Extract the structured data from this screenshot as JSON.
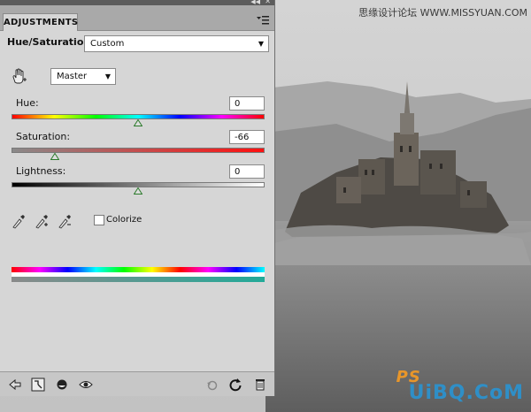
{
  "panel": {
    "tab_label": "ADJUSTMENTS",
    "title": "Hue/Saturation",
    "preset_value": "Custom",
    "channel_value": "Master",
    "hue": {
      "label": "Hue:",
      "value": "0",
      "level": 0.5
    },
    "saturation": {
      "label": "Saturation:",
      "value": "-66",
      "level": 0.17
    },
    "lightness": {
      "label": "Lightness:",
      "value": "0",
      "level": 0.5
    },
    "colorize_label": "Colorize",
    "colorize_checked": false
  },
  "watermark": {
    "top_text": "思缘设计论坛  WWW.MISSYUAN.COM",
    "logo_text": "UiBQ.CoM",
    "logo_ps": "PS"
  },
  "icons": [
    "hand-icon",
    "eyedropper-icon",
    "eyedropper-plus-icon",
    "eyedropper-minus-icon",
    "back-arrow-icon",
    "clip-layer-icon",
    "visibility-icon",
    "eye-icon",
    "reset-previous-icon",
    "reset-icon",
    "trash-icon",
    "panel-menu-icon",
    "collapse-icon"
  ]
}
